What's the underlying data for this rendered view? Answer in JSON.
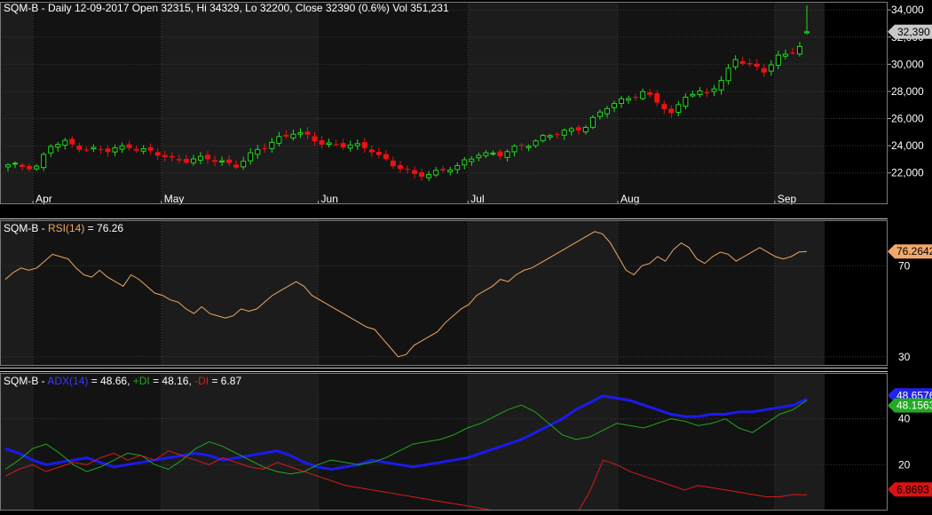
{
  "panels": {
    "price": {
      "title": "SQM-B - Daily 12-09-2017 Open 32315, Hi 34329, Lo 32200, Close 32390 (0.6%) Vol 351,231",
      "last_price_label": "32,390",
      "y_ticks": [
        "34,000",
        "32,000",
        "30,000",
        "28,000",
        "26,000",
        "24,000",
        "22,000"
      ],
      "x_ticks": [
        "Apr",
        "May",
        "Jun",
        "Jul",
        "Aug",
        "Sep"
      ]
    },
    "rsi": {
      "title_prefix": "SQM-B - ",
      "title_indicator": "RSI(14)",
      "title_value": " = 76.26",
      "last_value_label": "76.2642",
      "y_ticks": [
        "70",
        "30"
      ]
    },
    "adx": {
      "title_prefix": "SQM-B - ",
      "adx_name": "ADX(14)",
      "adx_value": " = 48.66, ",
      "pdi_name": "+DI",
      "pdi_value": " = 48.16, ",
      "mdi_name": "-DI",
      "mdi_value": " = 6.87",
      "adx_last_label": "48.6576",
      "pdi_last_label": "48.1563",
      "mdi_last_label": "6.8693",
      "y_ticks": [
        "40",
        "20"
      ]
    }
  },
  "colors": {
    "background": "#000000",
    "panel_bg": "#131313",
    "panel_bg_alt": "#1c1c1c",
    "grid": "#3a3a3a",
    "up": "#22dd22",
    "down": "#ee1111",
    "rsi": "#f0a860",
    "adx": "#1a1aee",
    "pdi": "#1fa81f",
    "mdi": "#d81a1a",
    "text": "#ffffff"
  },
  "chart_data": [
    {
      "type": "candlestick",
      "title": "SQM-B - Daily 12-09-2017 Open 32315, Hi 34329, Lo 32200, Close 32390 (0.6%) Vol 351,231",
      "ylim": [
        21000,
        34600
      ],
      "bars": 113,
      "months": [
        {
          "label": "Apr",
          "start_bar": 4
        },
        {
          "label": "May",
          "start_bar": 22
        },
        {
          "label": "Jun",
          "start_bar": 44
        },
        {
          "label": "Jul",
          "start_bar": 65
        },
        {
          "label": "Aug",
          "start_bar": 86
        },
        {
          "label": "Sep",
          "start_bar": 108
        }
      ],
      "close_anchors": [
        [
          0,
          22500
        ],
        [
          4,
          22500
        ],
        [
          6,
          24000
        ],
        [
          8,
          24200
        ],
        [
          11,
          23800
        ],
        [
          14,
          23600
        ],
        [
          17,
          24000
        ],
        [
          20,
          23500
        ],
        [
          23,
          23000
        ],
        [
          28,
          23000
        ],
        [
          32,
          22600
        ],
        [
          35,
          23600
        ],
        [
          38,
          24600
        ],
        [
          40,
          25000
        ],
        [
          44,
          24200
        ],
        [
          48,
          24000
        ],
        [
          51,
          23700
        ],
        [
          54,
          22600
        ],
        [
          57,
          21800
        ],
        [
          61,
          22200
        ],
        [
          63,
          22400
        ],
        [
          66,
          23500
        ],
        [
          69,
          23300
        ],
        [
          72,
          24000
        ],
        [
          75,
          24600
        ],
        [
          78,
          25000
        ],
        [
          81,
          25500
        ],
        [
          84,
          26800
        ],
        [
          87,
          27600
        ],
        [
          89,
          27900
        ],
        [
          91,
          27200
        ],
        [
          93,
          26300
        ],
        [
          95,
          27800
        ],
        [
          98,
          27800
        ],
        [
          100,
          28800
        ],
        [
          102,
          30500
        ],
        [
          104,
          29800
        ],
        [
          106,
          29500
        ],
        [
          108,
          30600
        ],
        [
          111,
          31200
        ],
        [
          112,
          32390
        ]
      ],
      "last": {
        "open": 32315,
        "high": 34329,
        "low": 32200,
        "close": 32390
      }
    },
    {
      "type": "line",
      "name": "RSI(14)",
      "ylim": [
        26,
        90
      ],
      "y_ticks": [
        70,
        30
      ],
      "values": [
        64,
        67,
        69,
        68,
        69,
        72,
        75,
        74,
        73,
        69,
        66,
        65,
        68,
        65,
        63,
        61,
        66,
        64,
        61,
        58,
        57,
        55,
        54,
        51,
        49,
        52,
        49,
        48,
        47,
        48,
        51,
        50,
        51,
        54,
        57,
        59,
        61,
        63,
        61,
        57,
        55,
        53,
        51,
        49,
        47,
        45,
        43,
        42,
        38,
        34,
        30,
        31,
        35,
        37,
        39,
        41,
        45,
        48,
        51,
        53,
        57,
        59,
        61,
        64,
        63,
        66,
        68,
        69,
        71,
        73,
        75,
        77,
        79,
        81,
        83,
        85,
        84,
        80,
        74,
        68,
        66,
        70,
        71,
        74,
        72,
        77,
        80,
        78,
        73,
        71,
        74,
        76,
        75,
        72,
        74,
        76,
        78,
        76,
        74,
        73,
        74,
        76,
        76.2642
      ]
    },
    {
      "type": "line",
      "series": [
        {
          "name": "ADX(14)",
          "values": [
            27,
            25,
            22,
            20,
            21,
            22,
            23,
            21,
            19,
            20,
            21,
            22,
            23,
            24,
            25,
            24,
            22,
            23,
            24,
            25,
            26,
            24,
            21,
            19,
            18,
            19,
            20,
            22,
            21,
            20,
            19,
            20,
            21,
            22,
            23,
            25,
            27,
            29,
            31,
            34,
            37,
            40,
            44,
            47,
            50,
            49,
            48,
            46,
            44,
            42,
            41,
            41,
            42,
            42,
            43,
            43,
            44,
            45,
            46,
            48.6576
          ]
        },
        {
          "name": "+DI",
          "values": [
            18,
            22,
            27,
            29,
            25,
            20,
            17,
            19,
            22,
            25,
            24,
            20,
            18,
            22,
            27,
            30,
            28,
            25,
            22,
            19,
            17,
            16,
            17,
            20,
            22,
            21,
            20,
            21,
            23,
            26,
            29,
            30,
            31,
            33,
            36,
            38,
            41,
            44,
            46,
            43,
            38,
            33,
            31,
            32,
            35,
            38,
            37,
            36,
            38,
            40,
            39,
            37,
            38,
            40,
            36,
            34,
            38,
            42,
            44,
            48.1563
          ]
        },
        {
          "name": "-DI",
          "values": [
            15,
            18,
            20,
            17,
            19,
            21,
            20,
            23,
            25,
            22,
            24,
            22,
            26,
            24,
            22,
            20,
            23,
            21,
            19,
            18,
            21,
            19,
            17,
            15,
            13,
            11,
            10,
            9,
            8,
            7,
            6,
            5,
            4,
            3,
            2,
            1,
            0,
            -1,
            -2,
            -3,
            -4,
            -6,
            -8,
            8,
            22,
            20,
            17,
            15,
            13,
            11,
            9,
            11,
            10,
            9,
            8,
            7,
            6,
            6,
            7,
            6.8693
          ]
        }
      ],
      "ylim": [
        0,
        60
      ],
      "y_ticks": [
        40,
        20
      ]
    }
  ]
}
